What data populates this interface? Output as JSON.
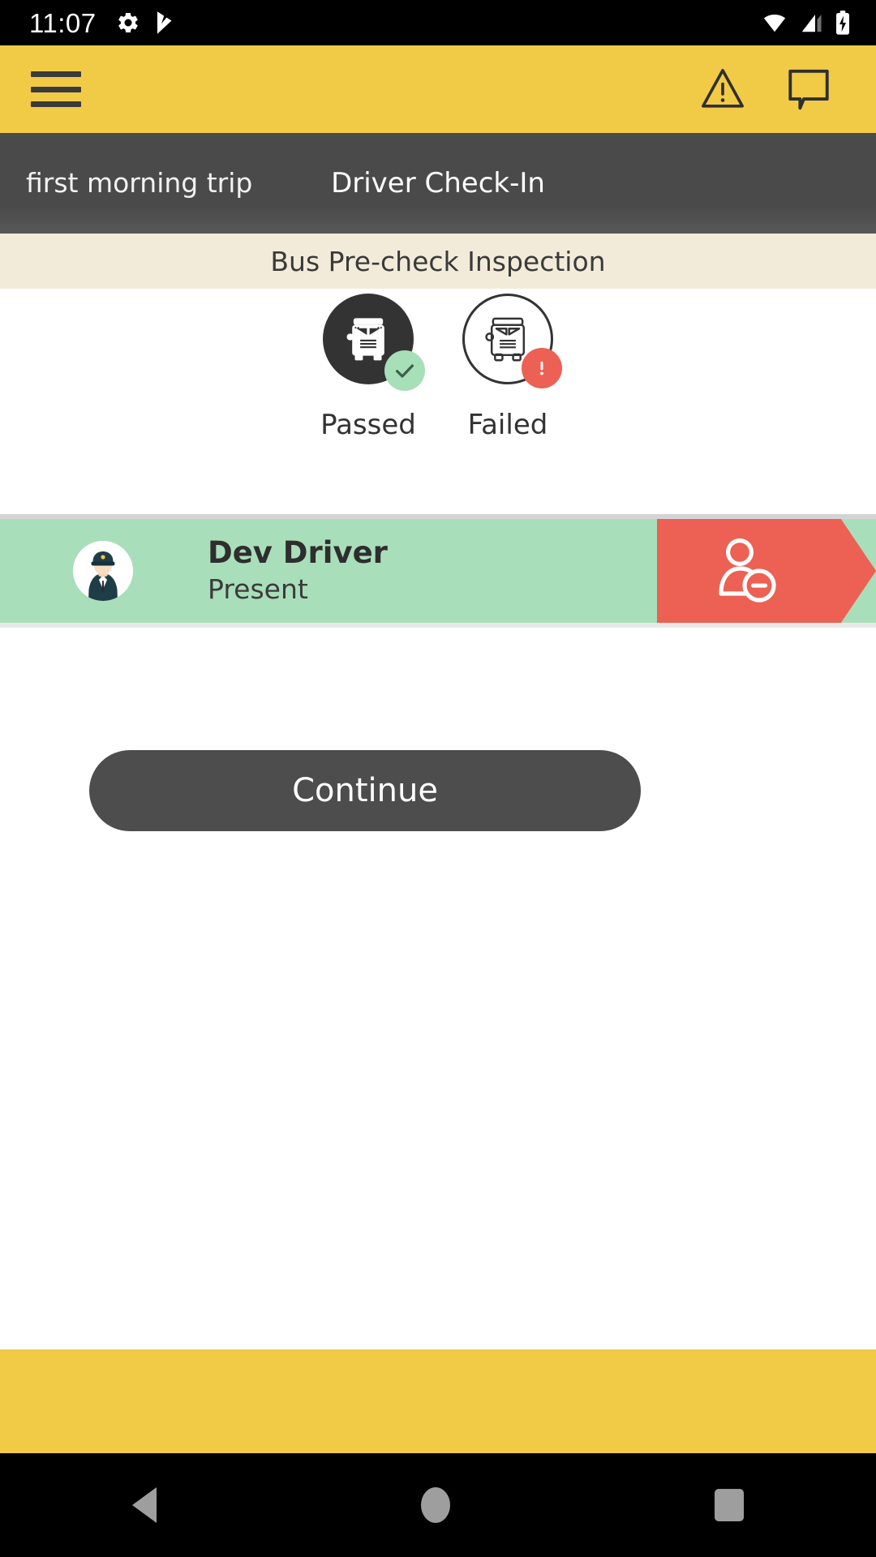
{
  "status_bar": {
    "time": "11:07",
    "left_icons": [
      "gear-icon",
      "media-play-icon"
    ],
    "right_icons": [
      "wifi-icon",
      "cellular-signal-icon",
      "battery-charging-icon"
    ]
  },
  "app_bar": {
    "menu_icon": "hamburger-menu-icon",
    "warning_icon": "warning-triangle-icon",
    "message_icon": "chat-bubble-icon",
    "background_color": "#F2CB46"
  },
  "trip_bar": {
    "trip_name": "first morning trip",
    "title": "Driver Check-In",
    "background_color": "#4A4A4A"
  },
  "section": {
    "subtitle": "Bus Pre-check Inspection",
    "background_color": "#F3EBDA"
  },
  "inspection": {
    "options": [
      {
        "label": "Passed",
        "state": "selected",
        "icon": "school-bus-icon",
        "badge": "check-badge",
        "badge_color": "#A6DFB8"
      },
      {
        "label": "Failed",
        "state": "unselected",
        "icon": "school-bus-icon",
        "badge": "exclamation-badge",
        "badge_color": "#EC6153"
      }
    ]
  },
  "driver": {
    "name": "Dev Driver",
    "status": "Present",
    "avatar_icon": "driver-avatar-icon",
    "row_color": "#A9DEBB",
    "swipe_action_icon": "remove-person-icon",
    "swipe_action_color": "#EC6153"
  },
  "actions": {
    "continue_label": "Continue",
    "continue_color": "#4D4D4D"
  },
  "nav_bar": {
    "back_icon": "back-triangle-icon",
    "home_icon": "home-circle-icon",
    "recents_icon": "recents-square-icon"
  }
}
